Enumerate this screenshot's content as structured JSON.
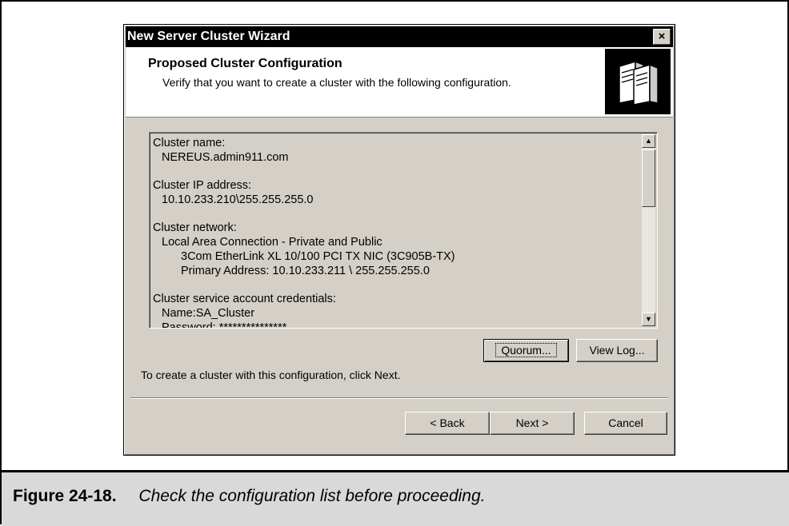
{
  "dialog": {
    "title": "New Server Cluster Wizard",
    "close_label": "×",
    "header_title": "Proposed Cluster Configuration",
    "header_subtitle": "Verify that you want to create a cluster with the following configuration.",
    "icon": "server-cluster-icon"
  },
  "summary": {
    "cluster_name_label": "Cluster name:",
    "cluster_name_value": "NEREUS.admin911.com",
    "ip_label": "Cluster IP address:",
    "ip_value": "10.10.233.210\\255.255.255.0",
    "network_label": "Cluster network:",
    "network_name": "Local Area Connection - Private and Public",
    "nic": "3Com EtherLink XL 10/100 PCI TX NIC (3C905B-TX)",
    "primary_address": "Primary Address: 10.10.233.211 \\ 255.255.255.0",
    "credentials_label": "Cluster service account credentials:",
    "account_name": "Name:SA_Cluster",
    "password": "Password: ***************"
  },
  "buttons": {
    "quorum": "Quorum...",
    "view_log": "View Log...",
    "back": "< Back",
    "next": "Next >",
    "cancel": "Cancel"
  },
  "footer_text": "To create a cluster with this configuration, click Next.",
  "caption": {
    "number": "Figure 24-18.",
    "text": "Check the configuration list before proceeding."
  }
}
